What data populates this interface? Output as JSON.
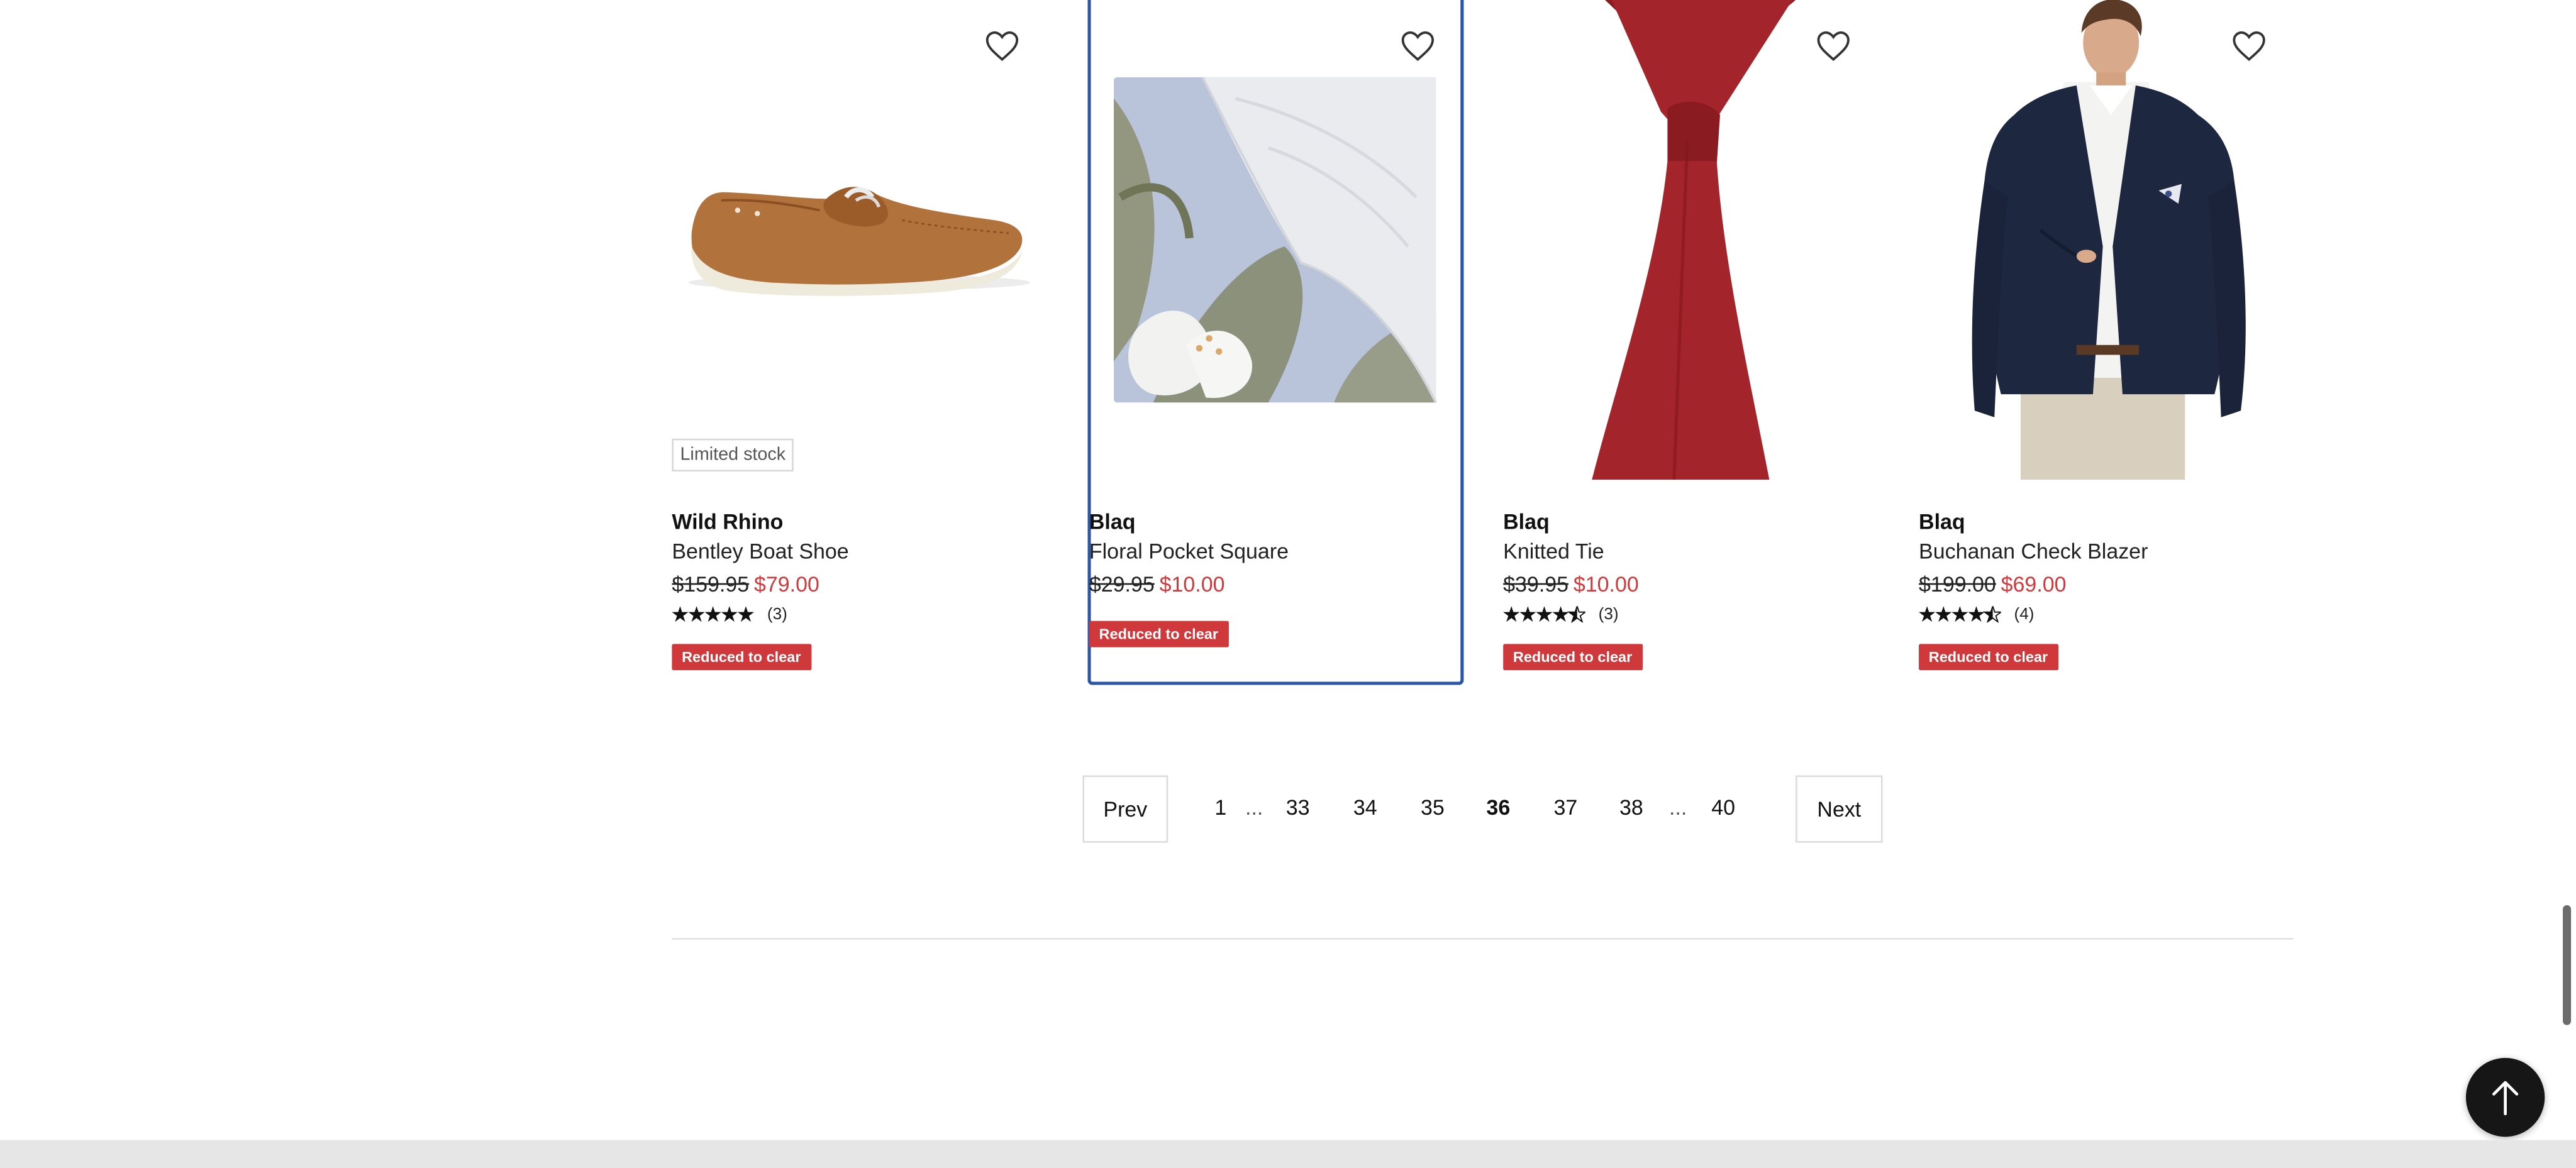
{
  "products": [
    {
      "brand": "Wild Rhino",
      "name": "Bentley Boat Shoe",
      "was_price": "$159.95",
      "now_price": "$79.00",
      "rating_count": "(3)",
      "rating": 5,
      "badge": "Reduced to clear",
      "stock_label": "Limited stock",
      "image": "boat-shoe"
    },
    {
      "brand": "Blaq",
      "name": "Floral Pocket Square",
      "was_price": "$29.95",
      "now_price": "$10.00",
      "badge": "Reduced to clear",
      "image": "pocket-square"
    },
    {
      "brand": "Blaq",
      "name": "Knitted Tie",
      "was_price": "$39.95",
      "now_price": "$10.00",
      "rating_count": "(3)",
      "rating": 4.5,
      "badge": "Reduced to clear",
      "image": "knitted-tie"
    },
    {
      "brand": "Blaq",
      "name": "Buchanan Check Blazer",
      "was_price": "$199.00",
      "now_price": "$69.00",
      "rating_count": "(4)",
      "rating": 4.5,
      "badge": "Reduced to clear",
      "image": "blazer"
    }
  ],
  "pagination": {
    "prev_label": "Prev",
    "next_label": "Next",
    "pages": [
      "1",
      "33",
      "34",
      "35",
      "36",
      "37",
      "38",
      "40"
    ],
    "ellipsis": "...",
    "current": "36"
  },
  "colors": {
    "sale_red": "#d0393b",
    "focus_blue": "#2b55a6",
    "back_to_top_bg": "#161616"
  },
  "icons": {
    "wishlist": "heart-outline-icon",
    "back_to_top": "arrow-up-icon",
    "rating": "star-icon"
  }
}
